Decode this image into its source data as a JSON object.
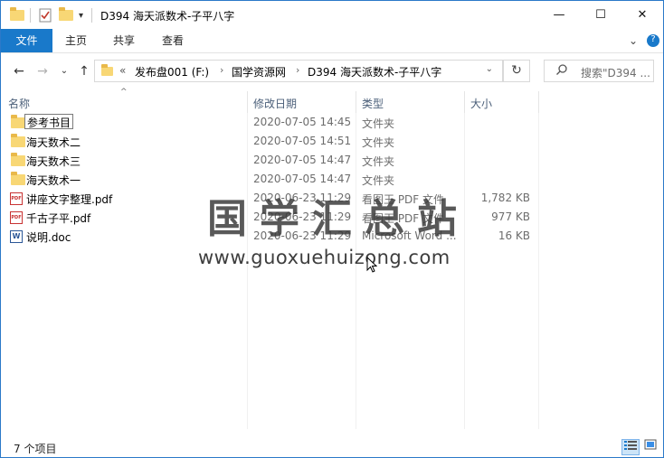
{
  "window": {
    "title": "D394 海天派数术-子平八字",
    "controls": {
      "minimize": "—",
      "maximize": "☐",
      "close": "✕"
    }
  },
  "quick_access": {
    "dropdown_glyph": "▾"
  },
  "ribbon": {
    "tabs": [
      "文件",
      "主页",
      "共享",
      "查看"
    ],
    "expand_glyph": "⌄",
    "help_glyph": "?"
  },
  "nav": {
    "back": "←",
    "forward": "→",
    "recent": "⌄",
    "up": "↑",
    "overflow": "«",
    "breadcrumb": [
      "发布盘001 (F:)",
      "国学资源网",
      "D394 海天派数术-子平八字"
    ],
    "separator": "›",
    "dropdown": "⌄",
    "refresh": "↻",
    "search_placeholder": "搜索\"D394 ..."
  },
  "columns": {
    "name": "名称",
    "date": "修改日期",
    "type": "类型",
    "size": "大小"
  },
  "files": [
    {
      "name": "参考书目",
      "date": "2020-07-05 14:45",
      "type": "文件夹",
      "size": "",
      "icon": "folder-icon"
    },
    {
      "name": "海天数术二",
      "date": "2020-07-05 14:51",
      "type": "文件夹",
      "size": "",
      "icon": "folder-icon"
    },
    {
      "name": "海天数术三",
      "date": "2020-07-05 14:47",
      "type": "文件夹",
      "size": "",
      "icon": "folder-icon"
    },
    {
      "name": "海天数术一",
      "date": "2020-07-05 14:47",
      "type": "文件夹",
      "size": "",
      "icon": "folder-icon"
    },
    {
      "name": "讲座文字整理.pdf",
      "date": "2020-06-23 11:29",
      "type": "看图王 PDF 文件",
      "size": "1,782 KB",
      "icon": "pdf-icon"
    },
    {
      "name": "千古子平.pdf",
      "date": "2020-06-23 11:29",
      "type": "看图王 PDF 文件",
      "size": "977 KB",
      "icon": "pdf-icon"
    },
    {
      "name": "说明.doc",
      "date": "2020-06-23 11:29",
      "type": "Microsoft Word ...",
      "size": "16 KB",
      "icon": "word-doc-icon"
    }
  ],
  "icon_glyphs": {
    "pdf": "PDF",
    "word": "W"
  },
  "watermark": {
    "title": "国学汇总站",
    "url": "www.guoxuehuizong.com"
  },
  "status": {
    "item_count": "7 个项目"
  },
  "colors": {
    "accent": "#1979ca",
    "folder": "#f8d775"
  }
}
